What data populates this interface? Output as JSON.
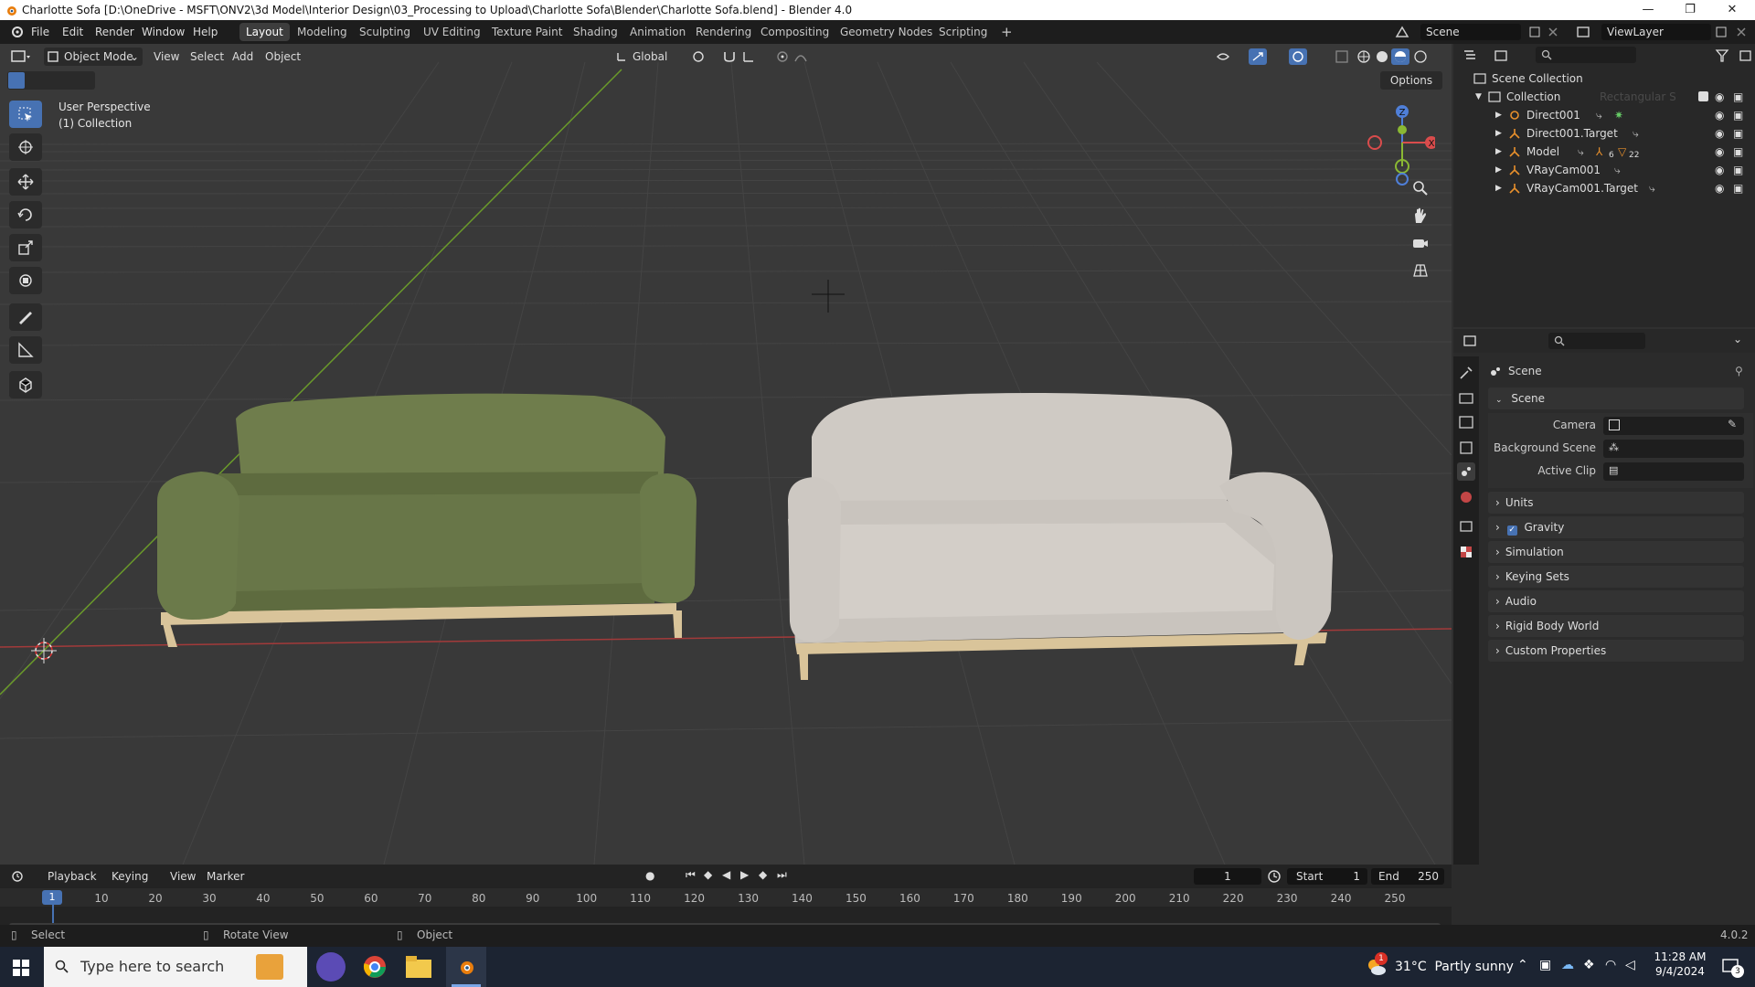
{
  "window": {
    "title": "Charlotte Sofa [D:\\OneDrive - MSFT\\ONV2\\3d Model\\Interior Design\\03_Processing to Upload\\Charlotte Sofa\\Blender\\Charlotte Sofa.blend] - Blender 4.0",
    "minimize": "—",
    "restore": "❐",
    "close": "✕"
  },
  "menubar": {
    "items": [
      "File",
      "Edit",
      "Render",
      "Window",
      "Help"
    ]
  },
  "workspaces": {
    "active": "Layout",
    "tabs": [
      "Layout",
      "Modeling",
      "Sculpting",
      "UV Editing",
      "Texture Paint",
      "Shading",
      "Animation",
      "Rendering",
      "Compositing",
      "Geometry Nodes",
      "Scripting"
    ],
    "add": "+"
  },
  "scene_selector": {
    "value": "Scene"
  },
  "viewlayer_selector": {
    "value": "ViewLayer"
  },
  "viewport_header": {
    "mode": "Object Mode",
    "menus": [
      "View",
      "Select",
      "Add",
      "Object"
    ],
    "orientation": "Global",
    "options": "Options"
  },
  "viewport_overlay": {
    "line1": "User Perspective",
    "line2": "(1) Collection"
  },
  "gizmo": {
    "x": "X",
    "y": "Y",
    "z": "Z"
  },
  "tools": [
    "select-box",
    "cursor",
    "move",
    "rotate",
    "scale",
    "transform",
    "annotate",
    "measure",
    "add-cube"
  ],
  "outliner": {
    "root": "Scene Collection",
    "collection": "Collection",
    "collection_ghost": "Rectangular S",
    "items": [
      {
        "name": "Direct001",
        "badge": ""
      },
      {
        "name": "Direct001.Target",
        "badge": ""
      },
      {
        "name": "Model",
        "badge": "6",
        "badge2": "22"
      },
      {
        "name": "VRayCam001",
        "badge": ""
      },
      {
        "name": "VRayCam001.Target",
        "badge": ""
      }
    ]
  },
  "properties": {
    "header": "Scene",
    "panel_open": "Scene",
    "fields": [
      {
        "label": "Camera",
        "value": ""
      },
      {
        "label": "Background Scene",
        "value": ""
      },
      {
        "label": "Active Clip",
        "value": ""
      }
    ],
    "panels": [
      "Units",
      "Gravity",
      "Simulation",
      "Keying Sets",
      "Audio",
      "Rigid Body World",
      "Custom Properties"
    ],
    "gravity_checked": true
  },
  "timeline": {
    "menus": [
      "Playback",
      "Keying",
      "View",
      "Marker"
    ],
    "current_frame": "1",
    "start_label": "Start",
    "start": "1",
    "end_label": "End",
    "end": "250",
    "ticks": [
      "1",
      "10",
      "20",
      "30",
      "40",
      "50",
      "60",
      "70",
      "80",
      "90",
      "100",
      "110",
      "120",
      "130",
      "140",
      "150",
      "160",
      "170",
      "180",
      "190",
      "200",
      "210",
      "220",
      "230",
      "240",
      "250"
    ]
  },
  "statusbar": {
    "select": "Select",
    "rotate": "Rotate View",
    "object": "Object",
    "version": "4.0.2"
  },
  "taskbar": {
    "search_placeholder": "Type here to search",
    "weather": "31°C  Partly sunny",
    "weather_badge": "1",
    "time": "11:28 AM",
    "date": "9/4/2024",
    "notifications": "3"
  },
  "colors": {
    "accent": "#4772b3",
    "sofa_green": "#6b7a4a",
    "sofa_white": "#cfcac4",
    "wood": "#d8c49a"
  }
}
